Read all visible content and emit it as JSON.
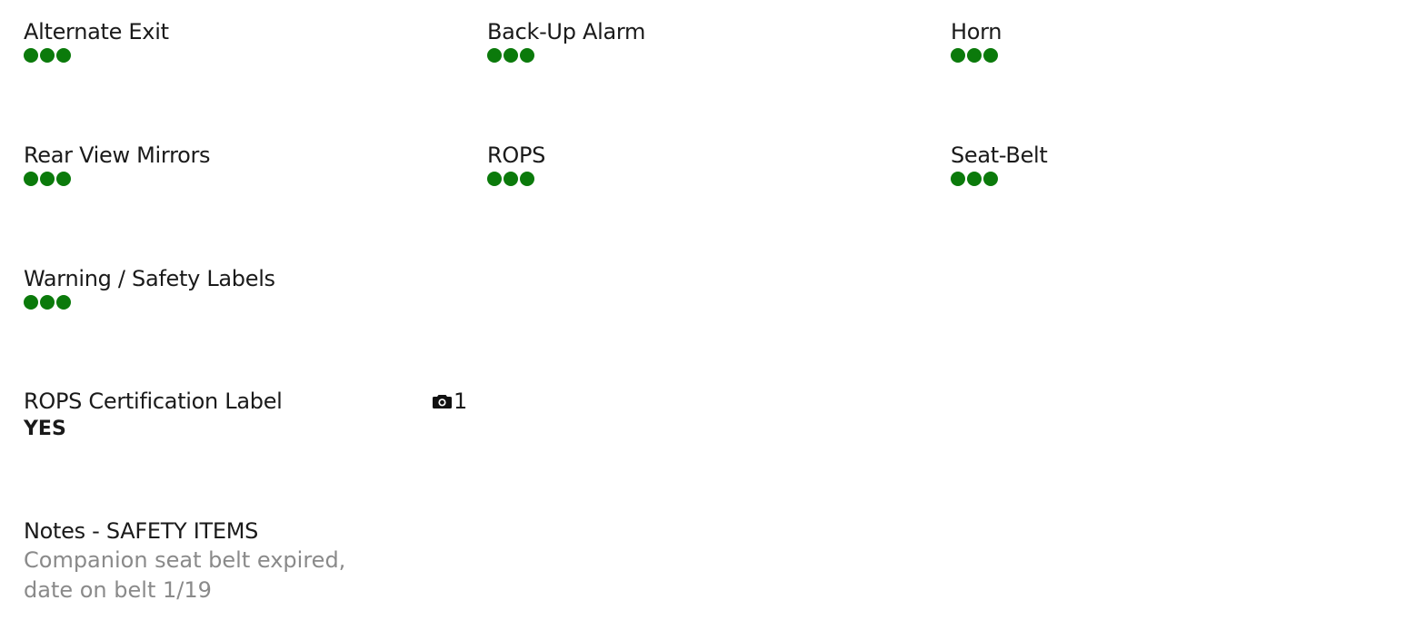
{
  "colors": {
    "good": "#0b7a0b",
    "notes_text": "#8a8a8a"
  },
  "items": [
    {
      "label": "Alternate Exit",
      "rating_dots": 3
    },
    {
      "label": "Back-Up Alarm",
      "rating_dots": 3
    },
    {
      "label": "Horn",
      "rating_dots": 3
    },
    {
      "label": "Rear View Mirrors",
      "rating_dots": 3
    },
    {
      "label": "ROPS",
      "rating_dots": 3
    },
    {
      "label": "Seat-Belt",
      "rating_dots": 3
    },
    {
      "label": "Warning / Safety Labels",
      "rating_dots": 3
    }
  ],
  "rops_cert": {
    "label": "ROPS Certification Label",
    "answer": "YES",
    "photo_icon": "camera-icon",
    "photo_count": "1"
  },
  "notes": {
    "title": "Notes - SAFETY ITEMS",
    "lines": [
      "Companion seat belt expired,",
      "date on belt 1/19"
    ]
  }
}
